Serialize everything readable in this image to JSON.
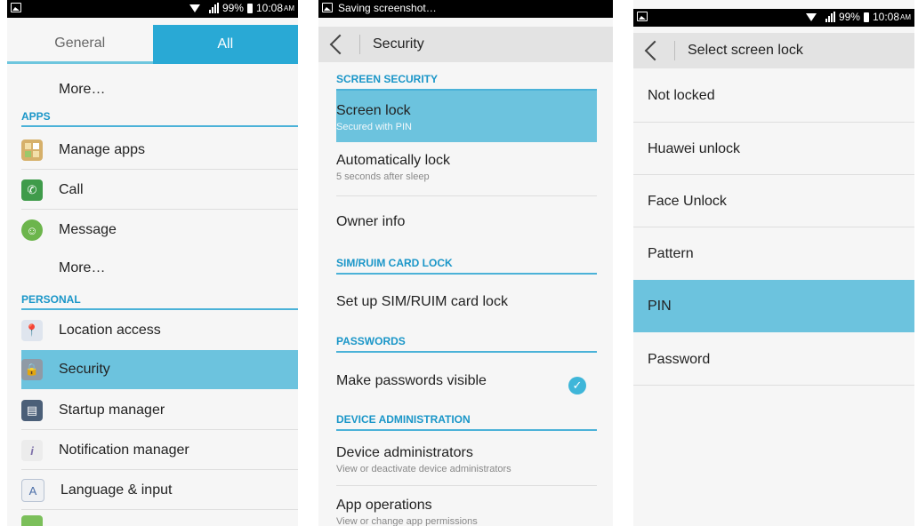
{
  "colors": {
    "accent": "#29a9d5",
    "selected": "#6cc3de",
    "section_text": "#1a96c8"
  },
  "screen1": {
    "status": {
      "battery": "99%",
      "time": "10:08",
      "ampm": "AM"
    },
    "tabs": [
      {
        "label": "General"
      },
      {
        "label": "All"
      }
    ],
    "rows": [
      {
        "label": "More…"
      },
      {
        "section": "APPS"
      },
      {
        "label": "Manage apps",
        "icon": "manage-apps-icon"
      },
      {
        "label": "Call",
        "icon": "call-icon"
      },
      {
        "label": "Message",
        "icon": "message-icon"
      },
      {
        "label": "More…"
      },
      {
        "section": "PERSONAL"
      },
      {
        "label": "Location access",
        "icon": "location-icon"
      },
      {
        "label": "Security",
        "icon": "lock-icon"
      },
      {
        "label": "Startup manager",
        "icon": "startup-manager-icon"
      },
      {
        "label": "Notification manager",
        "icon": "notification-icon"
      },
      {
        "label": "Language & input",
        "icon": "language-icon"
      }
    ]
  },
  "screen2": {
    "status": {
      "text": "Saving screenshot…"
    },
    "title": "Security",
    "sections": {
      "screen_security": "SCREEN SECURITY",
      "sim_lock": "SIM/RUIM CARD LOCK",
      "passwords": "PASSWORDS",
      "device_admin": "DEVICE ADMINISTRATION"
    },
    "items": {
      "screen_lock": {
        "title": "Screen lock",
        "sub": "Secured with PIN"
      },
      "auto_lock": {
        "title": "Automatically lock",
        "sub": "5 seconds after sleep"
      },
      "owner_info": {
        "title": "Owner info"
      },
      "sim_lock": {
        "title": "Set up SIM/RUIM card lock"
      },
      "passwords_visible": {
        "title": "Make passwords visible",
        "checked": true
      },
      "device_admins": {
        "title": "Device administrators",
        "sub": "View or deactivate device administrators"
      },
      "app_ops": {
        "title": "App operations",
        "sub": "View or change app permissions"
      }
    }
  },
  "screen3": {
    "status": {
      "battery": "99%",
      "time": "10:08",
      "ampm": "AM"
    },
    "title": "Select screen lock",
    "options": [
      {
        "label": "Not locked"
      },
      {
        "label": "Huawei unlock"
      },
      {
        "label": "Face Unlock"
      },
      {
        "label": "Pattern"
      },
      {
        "label": "PIN",
        "selected": true
      },
      {
        "label": "Password"
      }
    ]
  }
}
